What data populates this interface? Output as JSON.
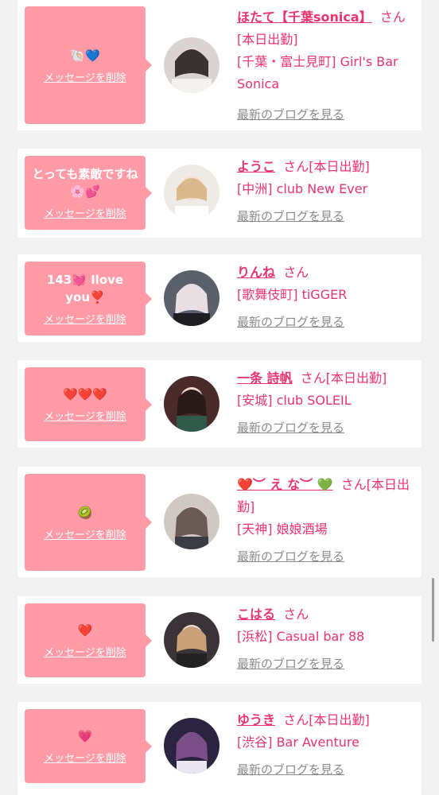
{
  "delete_label": "メッセージを削除",
  "blog_label": "最新のブログを見る",
  "suffix": "さん",
  "colors": {
    "bubble": "#ff9aa6",
    "accent": "#e8336d",
    "link_gray": "#8a8a8a"
  },
  "entries": [
    {
      "message": "🐚💙",
      "name": "ほたて【千葉sonica】",
      "status": "[本日出勤]",
      "area": "[千葉・富士見町] Girl's Bar Sonica"
    },
    {
      "message": "とっても素敵ですね🌸💕",
      "name": "ようこ",
      "status": "[本日出勤]",
      "area": "[中洲] club New Ever"
    },
    {
      "message": "143💓 Iloveyou❣️",
      "name": "りんね",
      "status": "",
      "area": "[歌舞伎町] tiGGER"
    },
    {
      "message": "❤️❤️❤️",
      "name": "一条 詩帆",
      "status": "[本日出勤]",
      "area": "[安城] club SOLEIL"
    },
    {
      "message": "🥝",
      "name": "❤️︶ え な︶ 💚",
      "status": "[本日出勤]",
      "area": "[天神] 娘娘酒場"
    },
    {
      "message": "❤️",
      "name": "こはる",
      "status": "",
      "area": "[浜松] Casual bar 88"
    },
    {
      "message": "💗",
      "name": "ゆうき",
      "status": "[本日出勤]",
      "area": "[渋谷] Bar Aventure"
    }
  ]
}
